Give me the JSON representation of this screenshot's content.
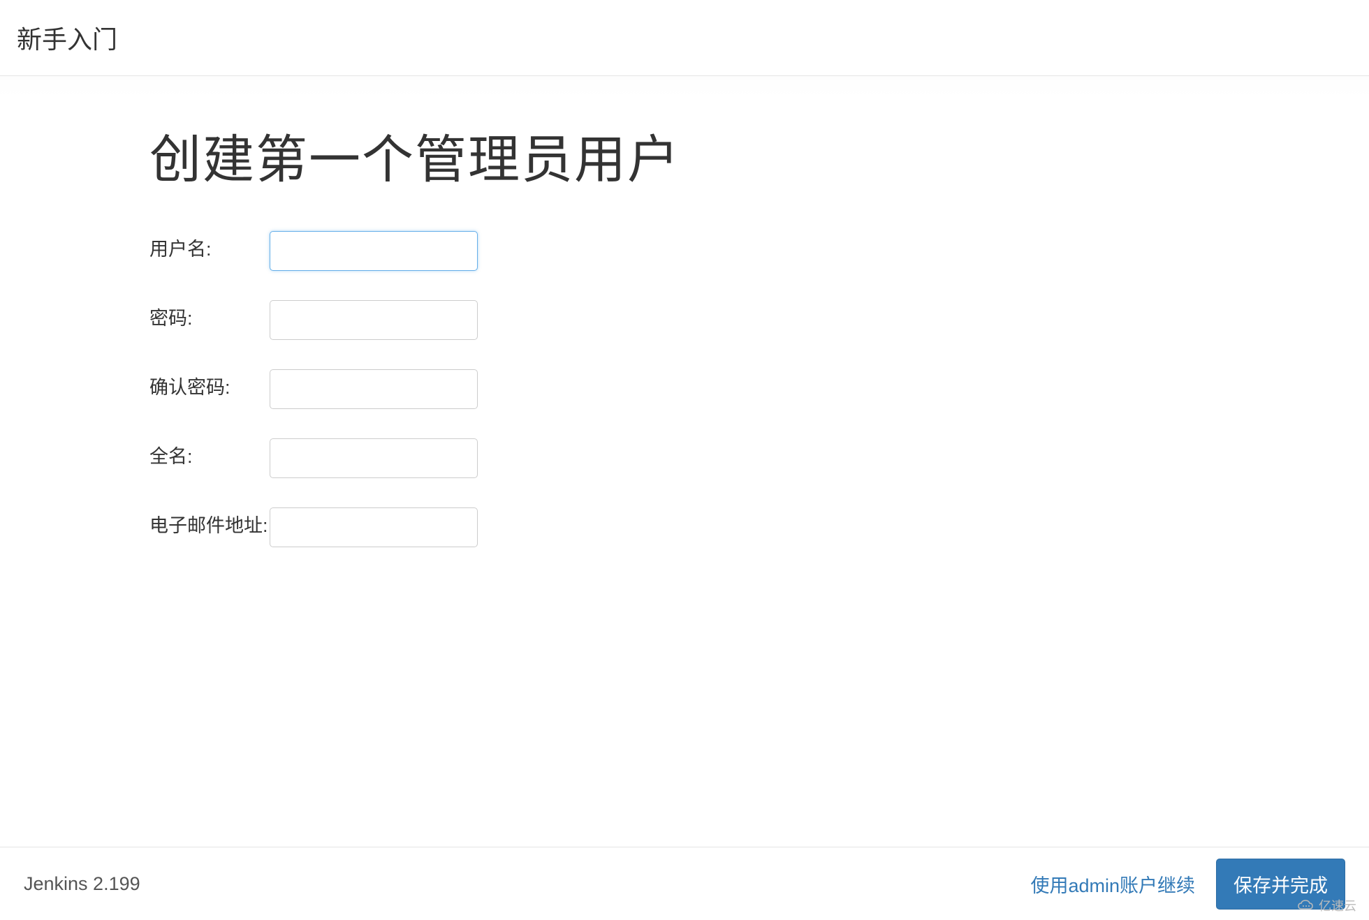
{
  "header": {
    "title": "新手入门"
  },
  "main": {
    "heading": "创建第一个管理员用户",
    "form": {
      "username": {
        "label": "用户名:",
        "value": ""
      },
      "password": {
        "label": "密码:",
        "value": ""
      },
      "confirm_password": {
        "label": "确认密码:",
        "value": ""
      },
      "fullname": {
        "label": "全名:",
        "value": ""
      },
      "email": {
        "label": "电子邮件地址:",
        "value": ""
      }
    }
  },
  "footer": {
    "version": "Jenkins 2.199",
    "continue_as_admin": "使用admin账户继续",
    "save_and_finish": "保存并完成"
  },
  "watermark": {
    "text": "亿速云"
  }
}
